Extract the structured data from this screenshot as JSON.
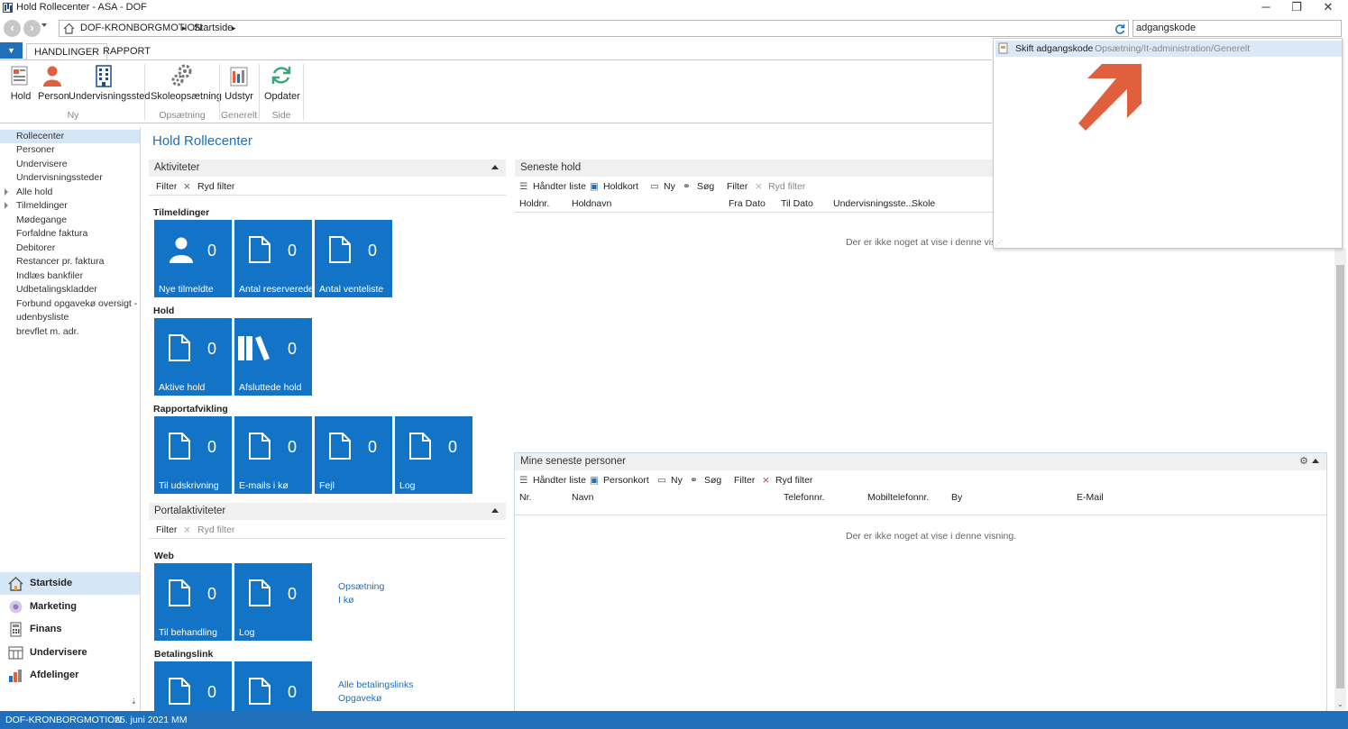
{
  "window": {
    "title": "Hold Rollecenter - ASA - DOF",
    "minimize": "─",
    "restore": "❐",
    "close": "✕"
  },
  "address": {
    "company": "DOF-KRONBORGMOTION",
    "page": "Startside",
    "sep": "▸",
    "search_value": "adgangskode"
  },
  "ribbon": {
    "tabs": [
      "HANDLINGER",
      "RAPPORT"
    ],
    "buttons": {
      "hold": "Hold",
      "person": "Person",
      "undervisningssted": "Undervisningssted",
      "skoleopsaetning": "Skoleopsætning",
      "udstyr": "Udstyr",
      "opdater": "Opdater"
    },
    "groups": {
      "ny": "Ny",
      "opsaetning": "Opsætning",
      "generelt": "Generelt",
      "side": "Side"
    }
  },
  "leftnav": {
    "items": [
      "Rollecenter",
      "Personer",
      "Undervisere",
      "Undervisningssteder",
      "Alle hold",
      "Tilmeldinger",
      "Mødegange",
      "Forfaldne faktura",
      "Debitorer",
      "Restancer pr. faktura",
      "Indlæs bankfiler",
      "Udbetalingskladder",
      "Forbund opgavekø oversigt - [...",
      "udenbysliste",
      "brevflet m. adr."
    ],
    "departments": [
      "Startside",
      "Marketing",
      "Finans",
      "Undervisere",
      "Afdelinger"
    ]
  },
  "page_title": "Hold Rollecenter",
  "aktiviteter": {
    "header": "Aktiviteter",
    "filter": "Filter",
    "ryd_filter": "Ryd filter",
    "groups": {
      "tilmeldinger": "Tilmeldinger",
      "hold": "Hold",
      "rapport": "Rapportafvikling"
    },
    "tiles": {
      "nye_tilmeldte": {
        "label": "Nye tilmeldte",
        "value": "0"
      },
      "antal_reserverede": {
        "label": "Antal reserverede",
        "value": "0"
      },
      "antal_venteliste": {
        "label": "Antal venteliste",
        "value": "0"
      },
      "aktive_hold": {
        "label": "Aktive hold",
        "value": "0"
      },
      "afsluttede_hold": {
        "label": "Afsluttede hold",
        "value": "0"
      },
      "til_udskrivning": {
        "label": "Til udskrivning",
        "value": "0"
      },
      "emails_i_koe": {
        "label": "E-mails i kø",
        "value": "0"
      },
      "fejl": {
        "label": "Fejl",
        "value": "0"
      },
      "log": {
        "label": "Log",
        "value": "0"
      }
    }
  },
  "portal": {
    "header": "Portalaktiviteter",
    "filter": "Filter",
    "ryd_filter": "Ryd filter",
    "web": "Web",
    "betalingslink": "Betalingslink",
    "tiles": {
      "til_behandling": {
        "label": "Til behandling",
        "value": "0"
      },
      "log": {
        "label": "Log",
        "value": "0"
      },
      "bl1": {
        "label": "",
        "value": "0"
      },
      "bl2": {
        "label": "",
        "value": "0"
      }
    },
    "links": {
      "opsaetning": "Opsætning",
      "i_koe": "I kø",
      "alle_betalingslinks": "Alle betalingslinks",
      "opgavekoe": "Opgavekø"
    }
  },
  "seneste_hold": {
    "header": "Seneste hold",
    "toolbar": {
      "haandter": "Håndter liste",
      "holdkort": "Holdkort",
      "ny": "Ny",
      "soeg": "Søg",
      "filter": "Filter",
      "ryd_filter": "Ryd filter"
    },
    "columns": [
      "Holdnr.",
      "Holdnavn",
      "Fra Dato",
      "Til Dato",
      "Undervisningsste...",
      "Skole"
    ],
    "empty": "Der er ikke noget at vise i denne visning."
  },
  "mine_personer": {
    "header": "Mine seneste personer",
    "toolbar": {
      "haandter": "Håndter liste",
      "personkort": "Personkort",
      "ny": "Ny",
      "soeg": "Søg",
      "filter": "Filter",
      "ryd_filter": "Ryd filter"
    },
    "columns": [
      "Nr.",
      "Navn",
      "Telefonnr.",
      "Mobiltelefonnr.",
      "By",
      "E-Mail"
    ],
    "empty": "Der er ikke noget at vise i denne visning."
  },
  "dropdown": {
    "result_name": "Skift adgangskode",
    "result_path": "Opsætning/It-administration/Generelt",
    "arrow_color": "#e0603e"
  },
  "status": {
    "company": "DOF-KRONBORGMOTION",
    "date": "25. juni 2021",
    "user": "MM"
  },
  "colors": {
    "accent": "#1f6fba",
    "tile": "#1373c6"
  }
}
